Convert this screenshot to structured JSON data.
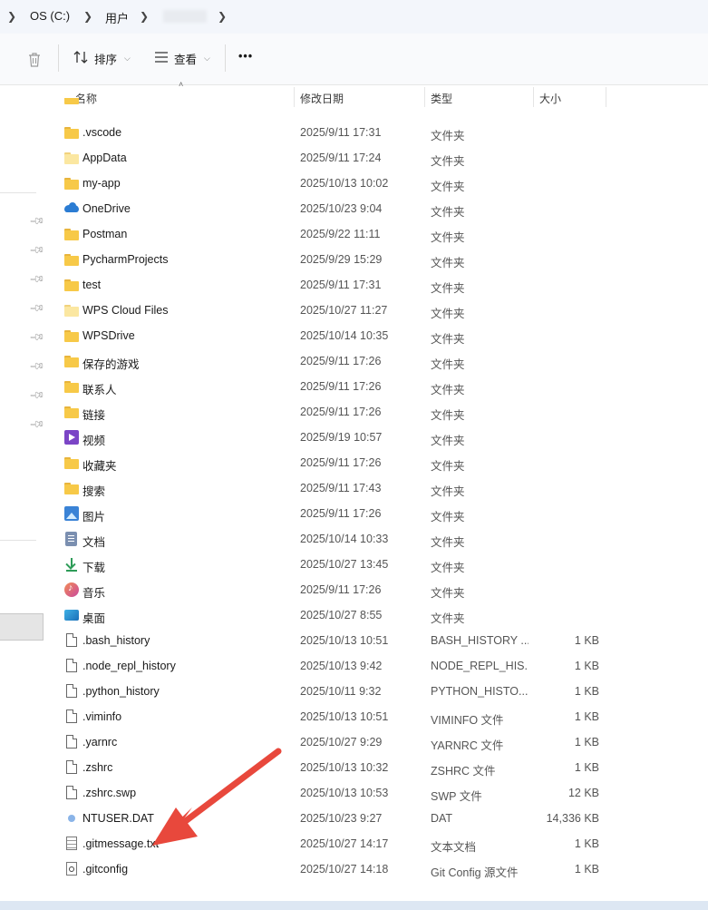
{
  "breadcrumb": {
    "drive": "OS (C:)",
    "users": "用户",
    "user_masked": ""
  },
  "toolbar": {
    "sort_label": "排序",
    "view_label": "查看",
    "more_label": "•••"
  },
  "columns": {
    "name": "名称",
    "date": "修改日期",
    "type": "类型",
    "size": "大小"
  },
  "files": [
    {
      "name": ".vscode",
      "date": "2025/9/11 17:31",
      "type": "文件夹",
      "size": "",
      "icon": "folder-icon"
    },
    {
      "name": "AppData",
      "date": "2025/9/11 17:24",
      "type": "文件夹",
      "size": "",
      "icon": "folder-pale-icon"
    },
    {
      "name": "my-app",
      "date": "2025/10/13 10:02",
      "type": "文件夹",
      "size": "",
      "icon": "folder-icon"
    },
    {
      "name": "OneDrive",
      "date": "2025/10/23 9:04",
      "type": "文件夹",
      "size": "",
      "icon": "onedrive-cloud-icon"
    },
    {
      "name": "Postman",
      "date": "2025/9/22 11:11",
      "type": "文件夹",
      "size": "",
      "icon": "folder-icon"
    },
    {
      "name": "PycharmProjects",
      "date": "2025/9/29 15:29",
      "type": "文件夹",
      "size": "",
      "icon": "folder-icon"
    },
    {
      "name": "test",
      "date": "2025/9/11 17:31",
      "type": "文件夹",
      "size": "",
      "icon": "folder-icon"
    },
    {
      "name": "WPS Cloud Files",
      "date": "2025/10/27 11:27",
      "type": "文件夹",
      "size": "",
      "icon": "folder-pale-icon"
    },
    {
      "name": "WPSDrive",
      "date": "2025/10/14 10:35",
      "type": "文件夹",
      "size": "",
      "icon": "folder-icon"
    },
    {
      "name": "保存的游戏",
      "date": "2025/9/11 17:26",
      "type": "文件夹",
      "size": "",
      "icon": "folder-icon"
    },
    {
      "name": "联系人",
      "date": "2025/9/11 17:26",
      "type": "文件夹",
      "size": "",
      "icon": "folder-icon"
    },
    {
      "name": "链接",
      "date": "2025/9/11 17:26",
      "type": "文件夹",
      "size": "",
      "icon": "folder-icon"
    },
    {
      "name": "视频",
      "date": "2025/9/19 10:57",
      "type": "文件夹",
      "size": "",
      "icon": "video-icon"
    },
    {
      "name": "收藏夹",
      "date": "2025/9/11 17:26",
      "type": "文件夹",
      "size": "",
      "icon": "folder-icon"
    },
    {
      "name": "搜索",
      "date": "2025/9/11 17:43",
      "type": "文件夹",
      "size": "",
      "icon": "folder-icon"
    },
    {
      "name": "图片",
      "date": "2025/9/11 17:26",
      "type": "文件夹",
      "size": "",
      "icon": "picture-icon"
    },
    {
      "name": "文档",
      "date": "2025/10/14 10:33",
      "type": "文件夹",
      "size": "",
      "icon": "document-icon"
    },
    {
      "name": "下载",
      "date": "2025/10/27 13:45",
      "type": "文件夹",
      "size": "",
      "icon": "download-icon"
    },
    {
      "name": "音乐",
      "date": "2025/9/11 17:26",
      "type": "文件夹",
      "size": "",
      "icon": "music-icon"
    },
    {
      "name": "桌面",
      "date": "2025/10/27 8:55",
      "type": "文件夹",
      "size": "",
      "icon": "desktop-icon"
    },
    {
      "name": ".bash_history",
      "date": "2025/10/13 10:51",
      "type": "BASH_HISTORY ...",
      "size": "1 KB",
      "icon": "file-icon"
    },
    {
      "name": ".node_repl_history",
      "date": "2025/10/13 9:42",
      "type": "NODE_REPL_HIS...",
      "size": "1 KB",
      "icon": "file-icon"
    },
    {
      "name": ".python_history",
      "date": "2025/10/11 9:32",
      "type": "PYTHON_HISTO...",
      "size": "1 KB",
      "icon": "file-icon"
    },
    {
      "name": ".viminfo",
      "date": "2025/10/13 10:51",
      "type": "VIMINFO 文件",
      "size": "1 KB",
      "icon": "file-icon"
    },
    {
      "name": ".yarnrc",
      "date": "2025/10/27 9:29",
      "type": "YARNRC 文件",
      "size": "1 KB",
      "icon": "file-icon"
    },
    {
      "name": ".zshrc",
      "date": "2025/10/13 10:32",
      "type": "ZSHRC 文件",
      "size": "1 KB",
      "icon": "file-icon"
    },
    {
      "name": ".zshrc.swp",
      "date": "2025/10/13 10:53",
      "type": "SWP 文件",
      "size": "12 KB",
      "icon": "file-icon"
    },
    {
      "name": "NTUSER.DAT",
      "date": "2025/10/23 9:27",
      "type": "DAT",
      "size": "14,336 KB",
      "icon": "dat-file-icon"
    },
    {
      "name": ".gitmessage.txt",
      "date": "2025/10/27 14:17",
      "type": "文本文档",
      "size": "1 KB",
      "icon": "text-file-icon"
    },
    {
      "name": ".gitconfig",
      "date": "2025/10/27 14:18",
      "type": "Git Config 源文件",
      "size": "1 KB",
      "icon": "config-file-icon"
    }
  ],
  "colors": {
    "annotation_arrow": "#e8483c",
    "folder": "#f7c948",
    "address_bar_bg": "#f3f6fb"
  }
}
